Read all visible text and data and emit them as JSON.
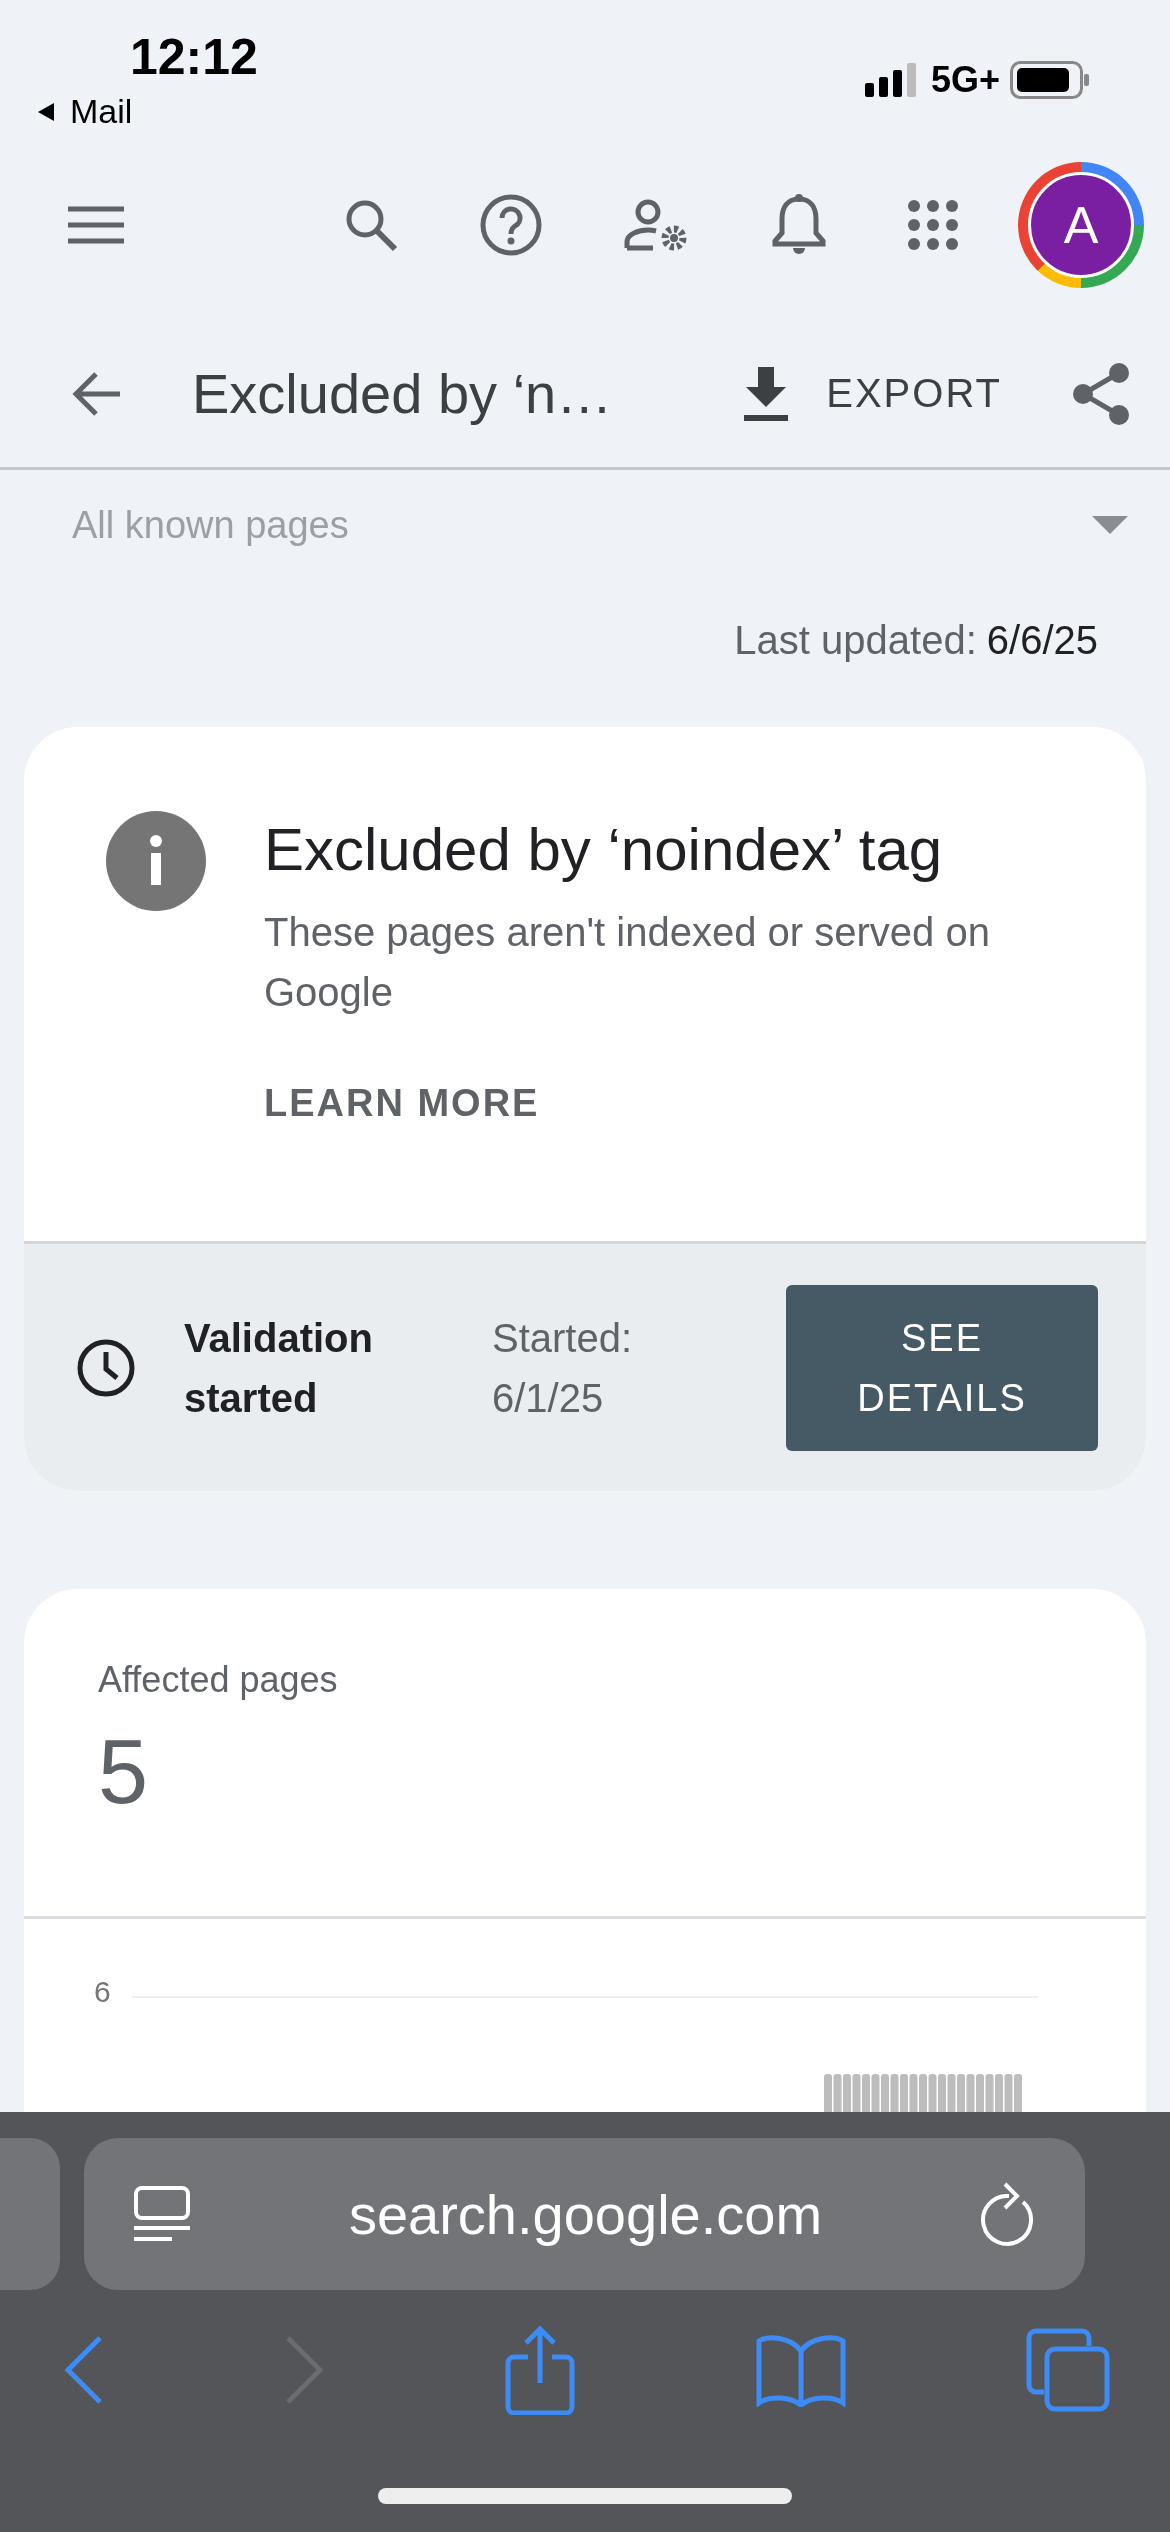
{
  "status_bar": {
    "time": "12:12",
    "back_label": "Mail",
    "network": "5G+"
  },
  "toolbar": {
    "avatar_letter": "A"
  },
  "header": {
    "title": "Excluded by ‘n…",
    "export_label": "EXPORT"
  },
  "filter": {
    "label": "All known pages"
  },
  "last_updated": {
    "label": "Last updated:",
    "date": "6/6/25"
  },
  "issue_card": {
    "title": "Excluded by ‘noindex’ tag",
    "description": "These pages aren't indexed or served on Google",
    "link": "LEARN MORE"
  },
  "validation": {
    "status": "Validation started",
    "started_label": "Started:",
    "started_date": "6/1/25",
    "button": "SEE DETAILS"
  },
  "affected": {
    "label": "Affected pages",
    "count": "5",
    "y_tick": "6"
  },
  "browser": {
    "url": "search.google.com",
    "forward_disabled": true
  }
}
